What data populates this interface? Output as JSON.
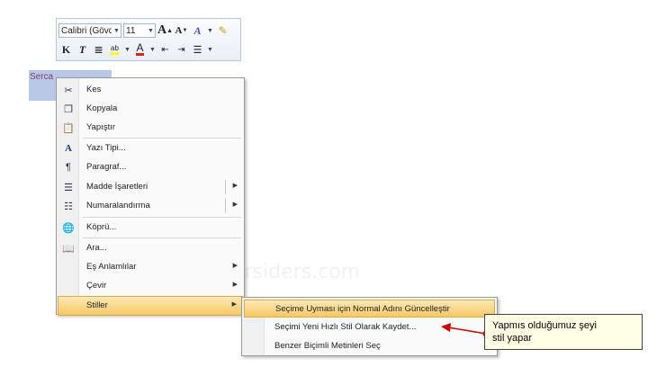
{
  "toolbar": {
    "font_name": "Calibri (Gövde)",
    "font_size": "11",
    "grow_font": "A",
    "shrink_font": "A",
    "bold": "K",
    "italic": "T",
    "font_color": "A"
  },
  "document": {
    "selected_text": "Serca"
  },
  "context_menu": {
    "items": [
      {
        "label": "Kes",
        "icon": "scissors-icon"
      },
      {
        "label": "Kopyala",
        "icon": "copy-icon"
      },
      {
        "label": "Yapıştır",
        "icon": "paste-icon"
      },
      {
        "label": "Yazı Tipi...",
        "icon": "font-icon"
      },
      {
        "label": "Paragraf...",
        "icon": "paragraph-icon"
      },
      {
        "label": "Madde İşaretleri",
        "icon": "bullets-icon"
      },
      {
        "label": "Numaralandırma",
        "icon": "numbering-icon"
      },
      {
        "label": "Köprü...",
        "icon": "hyperlink-icon"
      },
      {
        "label": "Ara...",
        "icon": "research-icon"
      },
      {
        "label": "Eş Anlamlılar",
        "icon": ""
      },
      {
        "label": "Çevir",
        "icon": ""
      },
      {
        "label": "Stiller",
        "icon": ""
      }
    ]
  },
  "styles_submenu": {
    "items": [
      {
        "label": "Seçime Uyması için Normal Adını Güncelleştir"
      },
      {
        "label": "Seçimi Yeni Hızlı Stil Olarak Kaydet..."
      },
      {
        "label": "Benzer Biçimli Metinleri Seç"
      }
    ]
  },
  "callout": {
    "text_line1": "Yapmıs olduğumuz şeyi",
    "text_line2": "stil yapar"
  },
  "watermark": "dersiders.com",
  "colors": {
    "highlight": "#f6c866",
    "font_color_bar": "#e02020",
    "highlight_bar": "#ffff00",
    "arrow": "#d00000"
  }
}
